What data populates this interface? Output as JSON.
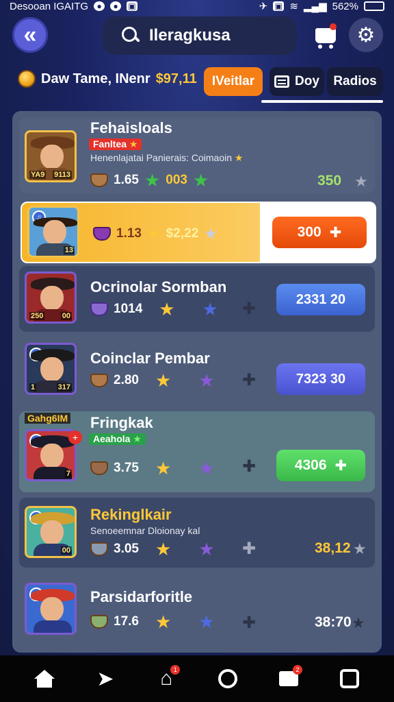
{
  "status_bar": {
    "left_text": "Desooan IGAITG",
    "battery": "562%"
  },
  "header": {
    "search_text": "Ileragkusa"
  },
  "balance": {
    "label": "Daw Tame, INenr",
    "amount": "$97,11"
  },
  "tabs": [
    {
      "label": "IVeitlar"
    },
    {
      "label": "Doy"
    },
    {
      "label": "Radios"
    }
  ],
  "rows": [
    {
      "name": "Fehaisloals",
      "tag": "Fanltea",
      "desc": "Henenlajatai Panierais: Coimaoin",
      "stat_value": "1.65",
      "stat_value2": "003",
      "score": "350",
      "avatar_left": "YA9",
      "avatar_right": "9113"
    },
    {
      "stat_value": "1.13",
      "price": "$2,22",
      "action_label": "300",
      "avatar_right": "13"
    },
    {
      "name": "Ocrinolar Sormban",
      "stat_value": "1014",
      "action_label": "2331 20",
      "avatar_left": "250",
      "avatar_right": "00"
    },
    {
      "name": "Coinclar Pembar",
      "stat_value": "2.80",
      "action_label": "7323 30",
      "avatar_left": "1",
      "avatar_right": "317"
    },
    {
      "name": "Fringkak",
      "banner": "Gahg6IM",
      "tag": "Aeahola",
      "stat_value": "3.75",
      "action_label": "4306",
      "avatar_right": "7"
    },
    {
      "name": "Rekinglkair",
      "desc": "Senoeemnar Dloionay  kal",
      "stat_value": "3.05",
      "score": "38,12",
      "avatar_right": "00"
    },
    {
      "name": "Parsidarforitle",
      "stat_value": "17.6",
      "score": "38:70"
    }
  ],
  "colors": {
    "accent_orange": "#f25a12",
    "accent_blue": "#4f76e0",
    "accent_green": "#4fd05e",
    "gold": "#ffc837"
  },
  "bottom_nav": [
    {
      "icon": "home-icon"
    },
    {
      "icon": "send-icon"
    },
    {
      "icon": "camera-icon",
      "badge": "1"
    },
    {
      "icon": "search-icon"
    },
    {
      "icon": "inbox-icon",
      "badge": "2"
    },
    {
      "icon": "profile-icon"
    }
  ]
}
